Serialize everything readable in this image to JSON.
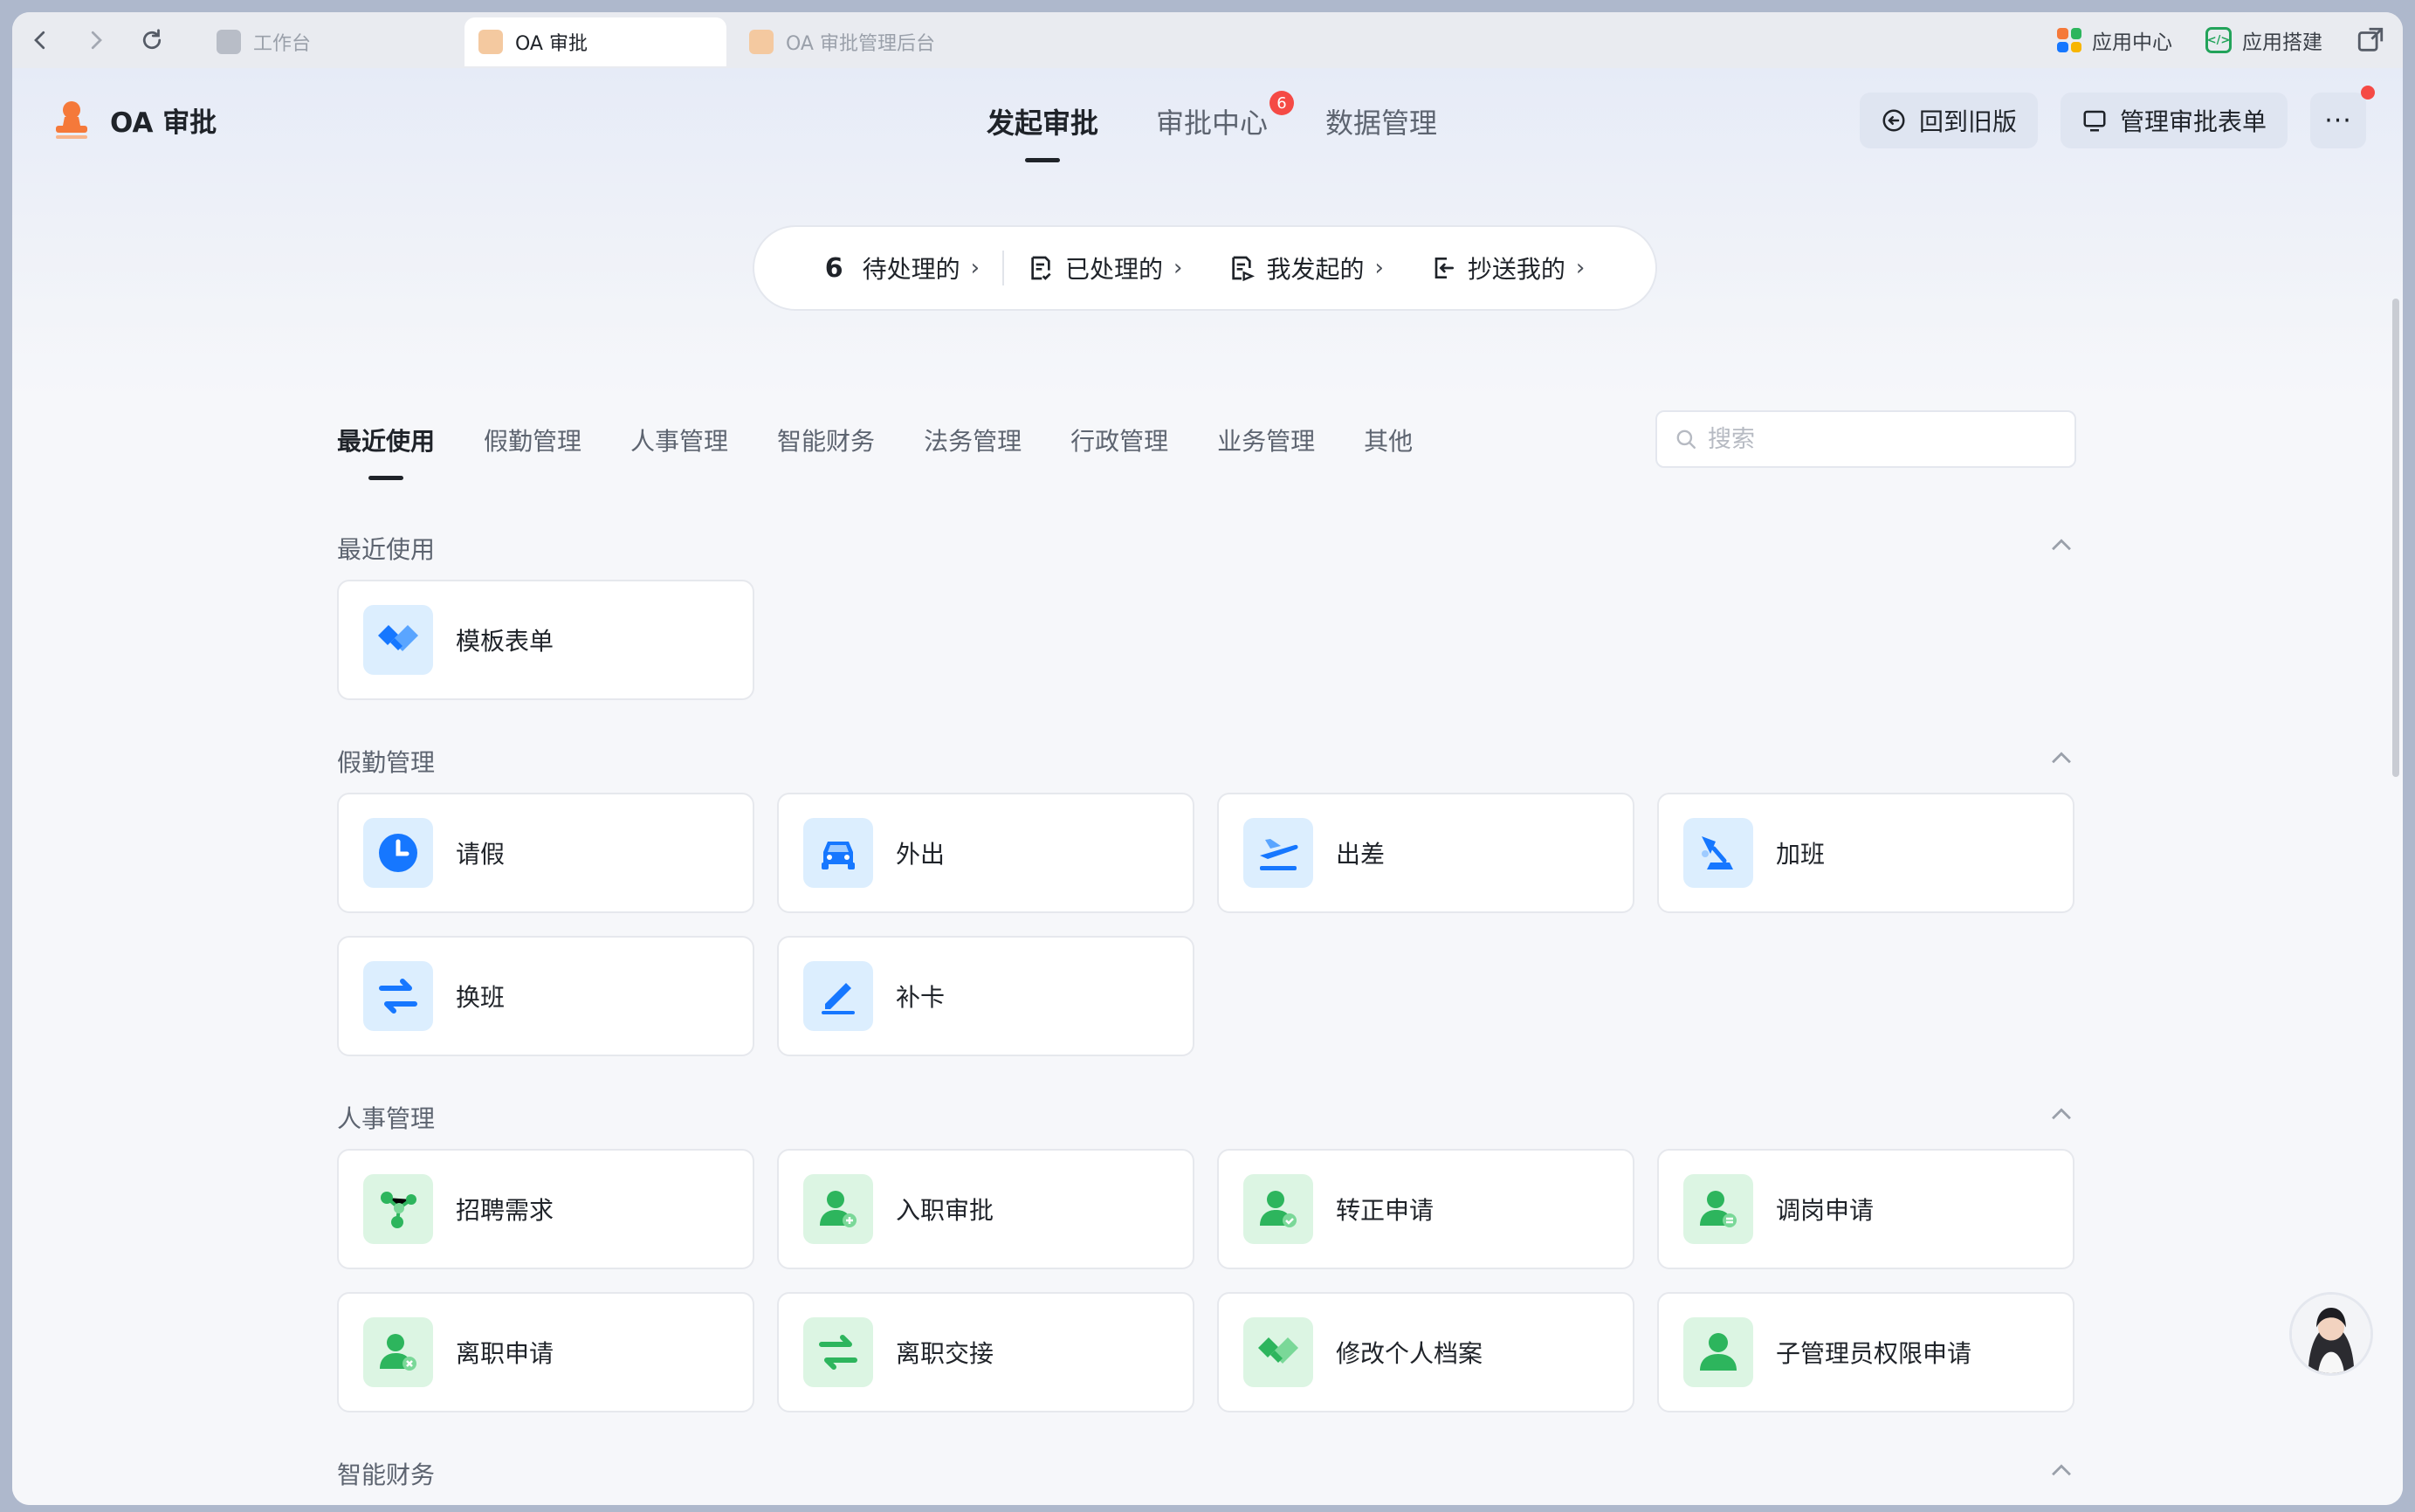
{
  "browser": {
    "tabs": [
      {
        "label": "工作台",
        "active": false
      },
      {
        "label": "OA 审批",
        "active": true
      },
      {
        "label": "OA 审批管理后台",
        "active": false
      }
    ],
    "right_items": [
      "应用中心",
      "应用搭建"
    ]
  },
  "app": {
    "name": "OA 审批",
    "main_tabs": [
      {
        "label": "发起审批",
        "active": true
      },
      {
        "label": "审批中心",
        "badge": "6"
      },
      {
        "label": "数据管理"
      }
    ],
    "buttons": {
      "old_version": "回到旧版",
      "manage_forms": "管理审批表单",
      "more": "···"
    }
  },
  "status": {
    "pending_count": "6",
    "pending": "待处理的",
    "processed": "已处理的",
    "initiated": "我发起的",
    "cc": "抄送我的",
    "chevron": "›"
  },
  "categories": [
    "最近使用",
    "假勤管理",
    "人事管理",
    "智能财务",
    "法务管理",
    "行政管理",
    "业务管理",
    "其他"
  ],
  "search": {
    "placeholder": "搜索"
  },
  "sections": [
    {
      "title": "最近使用",
      "items": [
        {
          "label": "模板表单",
          "icon": "handshake-icon"
        }
      ]
    },
    {
      "title": "假勤管理",
      "items": [
        {
          "label": "请假",
          "icon": "clock-icon"
        },
        {
          "label": "外出",
          "icon": "car-icon"
        },
        {
          "label": "出差",
          "icon": "plane-icon"
        },
        {
          "label": "加班",
          "icon": "desk-lamp-icon"
        },
        {
          "label": "换班",
          "icon": "swap-icon"
        },
        {
          "label": "补卡",
          "icon": "pen-icon"
        }
      ]
    },
    {
      "title": "人事管理",
      "items": [
        {
          "label": "招聘需求",
          "icon": "network-icon"
        },
        {
          "label": "入职审批",
          "icon": "user-add-icon"
        },
        {
          "label": "转正申请",
          "icon": "user-check-icon"
        },
        {
          "label": "调岗申请",
          "icon": "user-transfer-icon"
        },
        {
          "label": "离职申请",
          "icon": "user-remove-icon"
        },
        {
          "label": "离职交接",
          "icon": "swap-icon"
        },
        {
          "label": "修改个人档案",
          "icon": "handshake-icon"
        },
        {
          "label": "子管理员权限申请",
          "icon": "user-icon"
        }
      ]
    },
    {
      "title": "智能财务",
      "items": []
    }
  ],
  "colors": {
    "accent_blue": "#1677ff",
    "accent_green": "#2db55d",
    "badge_red": "#f54a45"
  }
}
